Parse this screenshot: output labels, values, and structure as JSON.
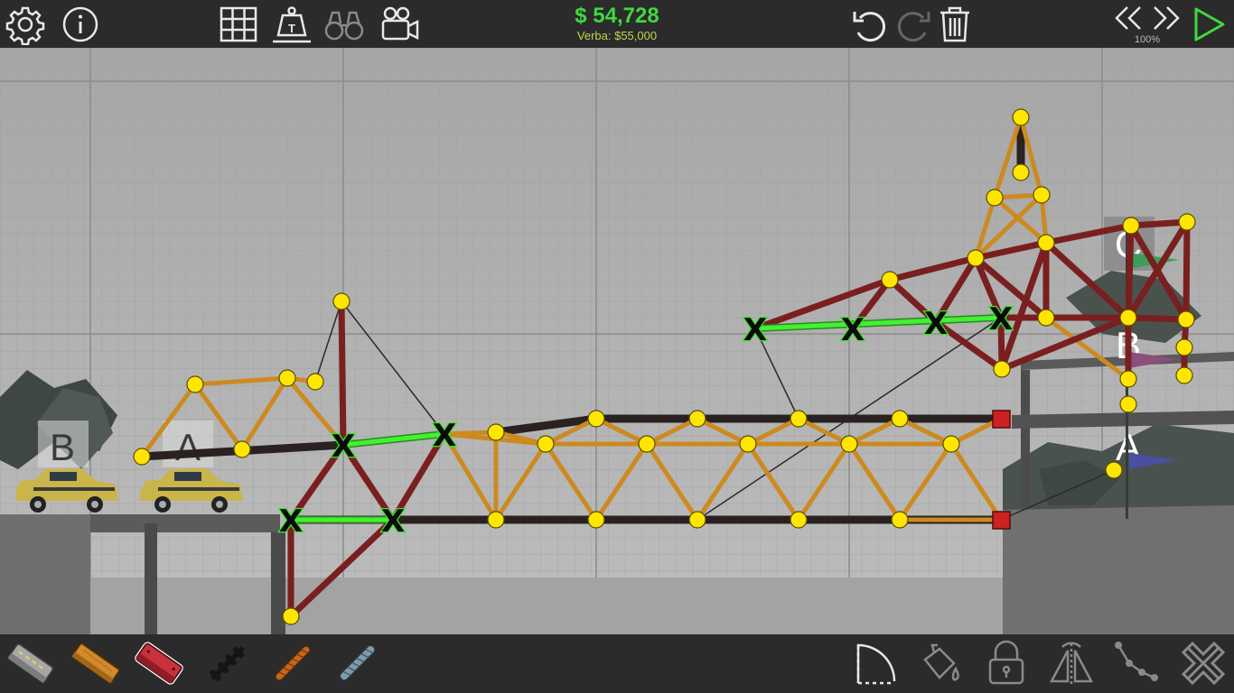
{
  "header": {
    "budget_value": "$ 54,728",
    "budget_limit": "Verba: $55,000",
    "speed": "100%"
  },
  "icons": {
    "top_left": [
      "gear-icon",
      "info-icon"
    ],
    "top_tools": [
      "grid-icon",
      "load-weight-icon",
      "binoculars-icon",
      "camera-icon"
    ],
    "top_right": [
      "undo-icon",
      "redo-icon",
      "trash-icon",
      "rewind-icon",
      "fast-forward-icon",
      "play-icon"
    ],
    "materials": [
      "road-material",
      "wood-material",
      "reinforced-road-material",
      "rope-material",
      "spring-material",
      "steel-cable-material"
    ],
    "edit_tools": [
      "arc-tool-icon",
      "paint-bucket-icon",
      "lock-icon",
      "mirror-icon",
      "split-joint-icon",
      "close-icon"
    ]
  },
  "scene": {
    "checkpoint_labels": [
      "B",
      "A",
      "C",
      "B",
      "A"
    ],
    "flags": [
      "green-flag",
      "purple-flag",
      "blue-flag"
    ],
    "vehicles": [
      "taxi-car",
      "taxi-car"
    ]
  },
  "colors": {
    "budget": "#3fd83f",
    "wood": "#cc8a1f",
    "steel": "#7a1f1f",
    "road": "#2a2220",
    "hydraulic": "#3ae12f",
    "joint": "#ffe600",
    "anchor": "#cc2222"
  }
}
